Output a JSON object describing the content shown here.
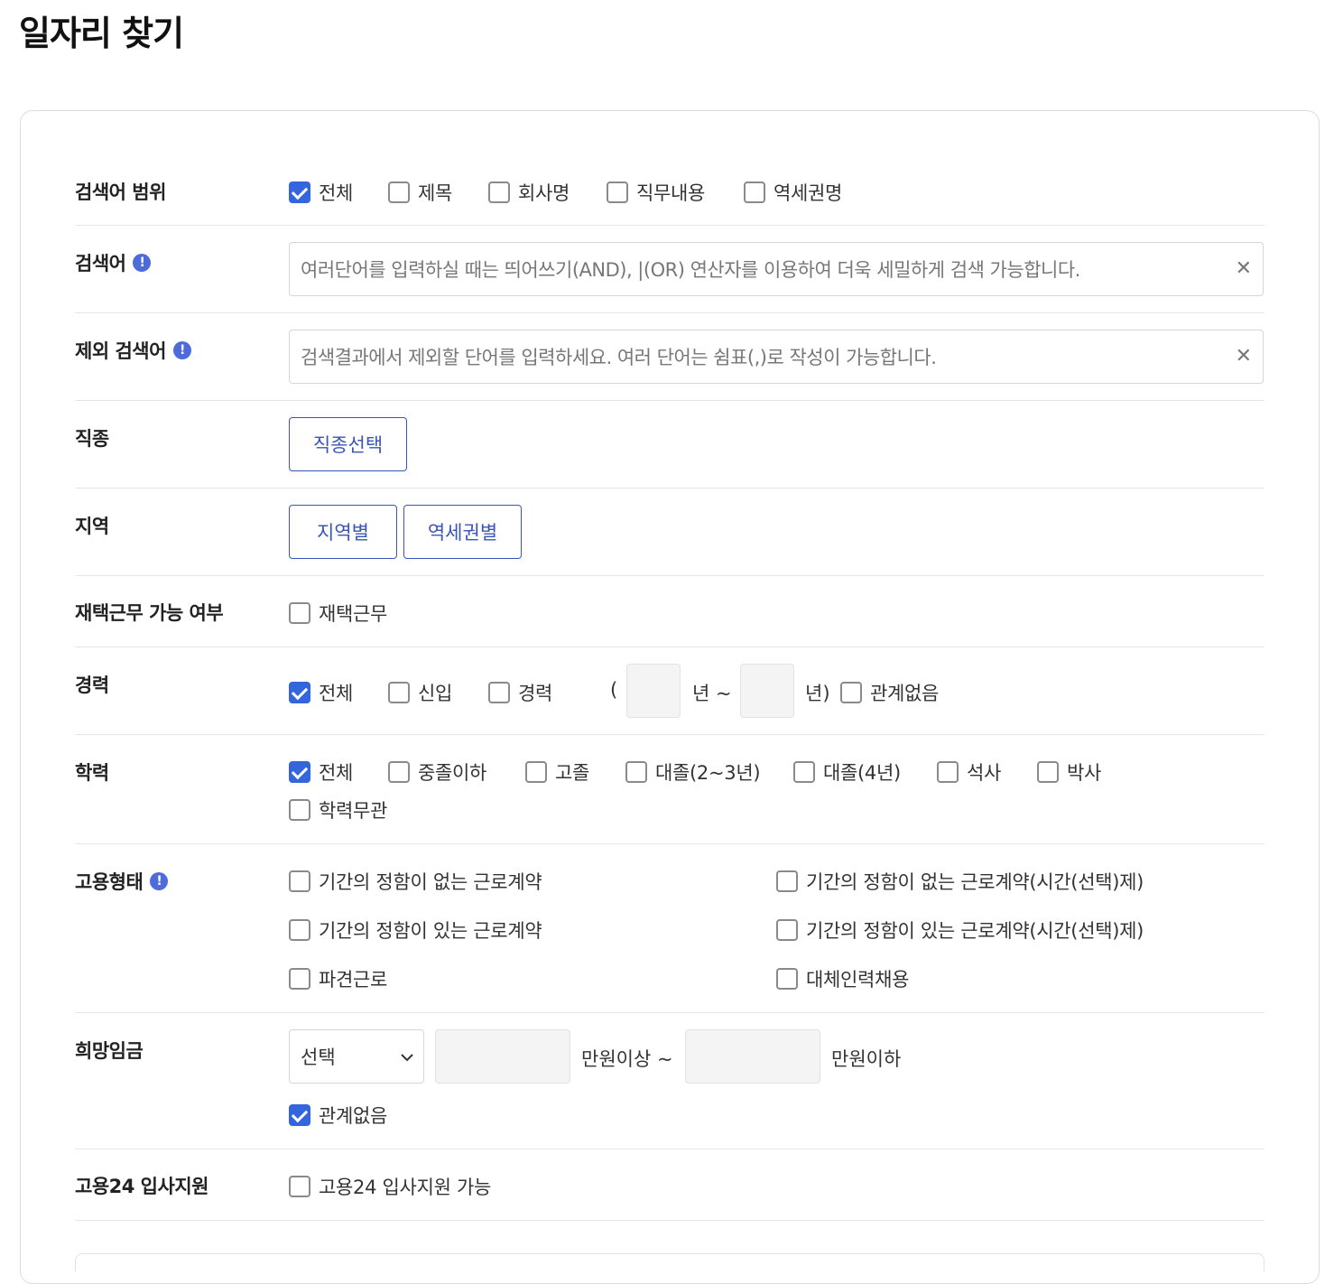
{
  "page_title": "일자리 찾기",
  "scope": {
    "label": "검색어 범위",
    "options": [
      {
        "label": "전체",
        "checked": true
      },
      {
        "label": "제목",
        "checked": false
      },
      {
        "label": "회사명",
        "checked": false
      },
      {
        "label": "직무내용",
        "checked": false
      },
      {
        "label": "역세권명",
        "checked": false
      }
    ]
  },
  "keyword": {
    "label": "검색어",
    "placeholder": "여러단어를 입력하실 때는 띄어쓰기(AND), |(OR) 연산자를 이용하여 더욱 세밀하게 검색 가능합니다.",
    "clear": "✕"
  },
  "exclude": {
    "label": "제외 검색어",
    "placeholder": "검색결과에서 제외할 단어를 입력하세요. 여러 단어는 쉼표(,)로 작성이 가능합니다.",
    "clear": "✕"
  },
  "job_type": {
    "label": "직종",
    "button": "직종선택"
  },
  "region": {
    "label": "지역",
    "buttons": [
      "지역별",
      "역세권별"
    ]
  },
  "remote": {
    "label": "재택근무 가능 여부",
    "option": {
      "label": "재택근무",
      "checked": false
    }
  },
  "career": {
    "label": "경력",
    "options": [
      {
        "label": "전체",
        "checked": true
      },
      {
        "label": "신입",
        "checked": false
      },
      {
        "label": "경력",
        "checked": false
      }
    ],
    "open_paren": "(",
    "year_tilde": "년 ~",
    "year_close": "년)",
    "no_matter": {
      "label": "관계없음",
      "checked": false
    }
  },
  "education": {
    "label": "학력",
    "options": [
      {
        "label": "전체",
        "checked": true
      },
      {
        "label": "중졸이하",
        "checked": false
      },
      {
        "label": "고졸",
        "checked": false
      },
      {
        "label": "대졸(2~3년)",
        "checked": false
      },
      {
        "label": "대졸(4년)",
        "checked": false
      },
      {
        "label": "석사",
        "checked": false
      },
      {
        "label": "박사",
        "checked": false
      },
      {
        "label": "학력무관",
        "checked": false
      }
    ]
  },
  "employment": {
    "label": "고용형태",
    "options": [
      {
        "label": "기간의 정함이 없는 근로계약",
        "checked": false
      },
      {
        "label": "기간의 정함이 없는 근로계약(시간(선택)제)",
        "checked": false
      },
      {
        "label": "기간의 정함이 있는 근로계약",
        "checked": false
      },
      {
        "label": "기간의 정함이 있는 근로계약(시간(선택)제)",
        "checked": false
      },
      {
        "label": "파견근로",
        "checked": false
      },
      {
        "label": "대체인력채용",
        "checked": false
      }
    ]
  },
  "salary": {
    "label": "희망임금",
    "select_value": "선택",
    "min_suffix": "만원이상 ~",
    "max_suffix": "만원이하",
    "no_matter": {
      "label": "관계없음",
      "checked": true
    }
  },
  "apply24": {
    "label": "고용24 입사지원",
    "option": {
      "label": "고용24 입사지원 가능",
      "checked": false
    }
  }
}
